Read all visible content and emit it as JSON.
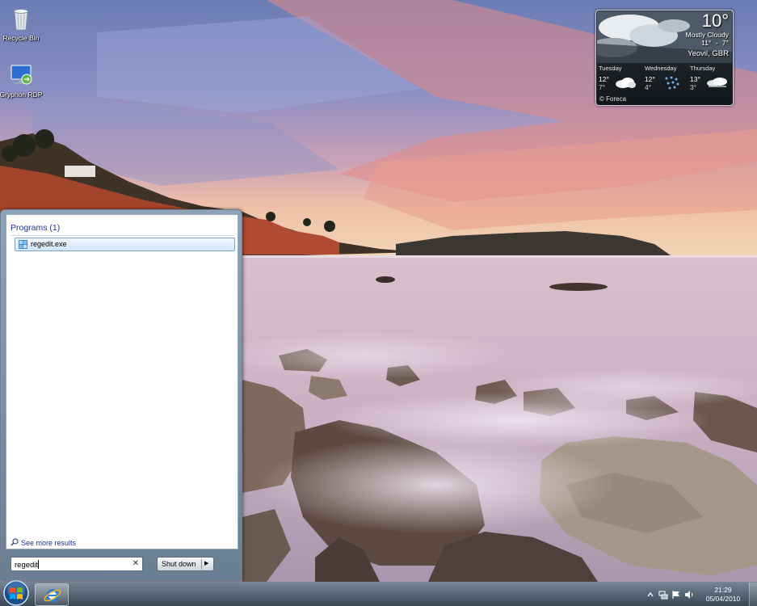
{
  "desktop": {
    "icons": [
      {
        "label": "Recycle Bin",
        "icon": "recycle-bin-icon"
      },
      {
        "label": "Gryphon RDP",
        "icon": "remote-desktop-icon"
      }
    ]
  },
  "weather": {
    "temperature": "10°",
    "condition": "Mostly Cloudy",
    "range": "11° - 7°",
    "location": "Yeovil, GBR",
    "forecast": [
      {
        "day": "Tuesday",
        "high": "12°",
        "low": "7°",
        "icon": "partly-cloudy-icon"
      },
      {
        "day": "Wednesday",
        "high": "12°",
        "low": "4°",
        "icon": "rain-icon"
      },
      {
        "day": "Thursday",
        "high": "13°",
        "low": "3°",
        "icon": "cloudy-icon"
      }
    ],
    "credit": "© Foreca"
  },
  "start_menu": {
    "header": "Programs (1)",
    "results": [
      {
        "label": "regedit.exe",
        "icon": "registry-editor-icon"
      }
    ],
    "see_more": "See more results",
    "search_value": "regedit",
    "shutdown_label": "Shut down"
  },
  "taskbar": {
    "pinned": [
      {
        "name": "Internet Explorer",
        "icon": "internet-explorer-icon"
      }
    ],
    "clock_time": "21:29",
    "clock_date": "05/04/2010",
    "tray_icons": [
      "chevron-up-icon",
      "network-icon",
      "flag-icon",
      "volume-icon"
    ]
  },
  "colors": {
    "start_menu_header": "#1e3287",
    "selection_border": "#7da2ce",
    "sky_top": "#6d7fb2",
    "sunset_pink": "#e48b86"
  }
}
